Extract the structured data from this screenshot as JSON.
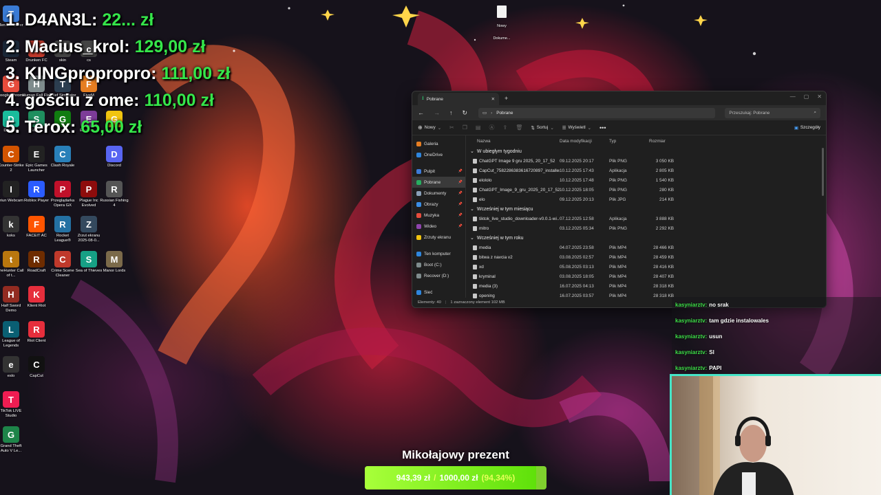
{
  "leaderboard": [
    {
      "name": "1. D4AN3L:",
      "amount": "22... zł"
    },
    {
      "name": "2. Macius_krol:",
      "amount": "129,00 zł"
    },
    {
      "name": "3. KINGpropropro:",
      "amount": "111,00 zł"
    },
    {
      "name": "4. gościu z ome:",
      "amount": "110,00 zł"
    },
    {
      "name": "5. Terox:",
      "amount": "65,00 zł"
    }
  ],
  "desktop": {
    "icons": [
      {
        "label": "Ten komputer",
        "icon": "computer-icon",
        "color": "#3a7bd5"
      },
      {
        "label": "Steam",
        "icon": "steam-icon",
        "color": "#1b2838"
      },
      {
        "label": "Drunken FC",
        "icon": "game-icon",
        "color": "#c0392b"
      },
      {
        "label": "skin",
        "icon": "folder-icon",
        "color": "#444"
      },
      {
        "label": "cs",
        "icon": "folder-icon",
        "color": "#444"
      },
      {
        "label": "Google Chrome",
        "icon": "chrome-icon",
        "color": "#e74c3c"
      },
      {
        "label": "Human Fall Flat",
        "icon": "game-icon",
        "color": "#7f8c8d"
      },
      {
        "label": "Thief Simulator",
        "icon": "game-icon",
        "color": "#2c3e50"
      },
      {
        "label": "FiveM",
        "icon": "fivem-icon",
        "color": "#e67e22"
      },
      {
        "label": "Desktop",
        "icon": "app-icon",
        "color": "#1abc9c"
      },
      {
        "label": "Studio",
        "icon": "app-icon",
        "color": "#1f8f5f"
      },
      {
        "label": "Games",
        "icon": "xbox-icon",
        "color": "#107c10"
      },
      {
        "label": "Escape ...",
        "icon": "game-icon",
        "color": "#7d3c98"
      },
      {
        "label": "Games ...",
        "icon": "rockstar-icon",
        "color": "#f1c40f"
      },
      {
        "label": "Counter-Strike 2",
        "icon": "cs2-icon",
        "color": "#d35400"
      },
      {
        "label": "Epic Games Launcher",
        "icon": "epic-icon",
        "color": "#222"
      },
      {
        "label": "Clash Royale",
        "icon": "game-icon",
        "color": "#2980b9"
      },
      {
        "label": "Discord",
        "icon": "discord-icon",
        "color": "#5865f2"
      },
      {
        "label": "Iriun Webcam",
        "icon": "webcam-icon",
        "color": "#222"
      },
      {
        "label": "Roblox Player",
        "icon": "roblox-icon",
        "color": "#2b5cff"
      },
      {
        "label": "Przeglądarka Opera GX",
        "icon": "opera-icon",
        "color": "#c0102a"
      },
      {
        "label": "Plague Inc Evolved",
        "icon": "biohazard-icon",
        "color": "#8e0c0c"
      },
      {
        "label": "Russian Fishing 4",
        "icon": "game-icon",
        "color": "#555"
      },
      {
        "label": "koks",
        "icon": "file-icon",
        "color": "#333"
      },
      {
        "label": "FACEIT AC",
        "icon": "faceit-icon",
        "color": "#ff5500"
      },
      {
        "label": "Rocket League®",
        "icon": "rocket-league-icon",
        "color": "#2471a3"
      },
      {
        "label": "Zrzut ekranu 2025-08-0...",
        "icon": "image-icon",
        "color": "#34495e"
      },
      {
        "label": "theHunter Call of t...",
        "icon": "game-icon",
        "color": "#b9770e"
      },
      {
        "label": "RoadCraft",
        "icon": "game-icon",
        "color": "#6e2c00"
      },
      {
        "label": "Crime Scene Cleaner",
        "icon": "game-icon",
        "color": "#c0392b"
      },
      {
        "label": "Sea of Thieves",
        "icon": "game-icon",
        "color": "#16a085"
      },
      {
        "label": "Manor Lords",
        "icon": "game-icon",
        "color": "#7b6a4a"
      },
      {
        "label": "Half Sword Demo",
        "icon": "game-icon",
        "color": "#922b21"
      },
      {
        "label": "Klient Riot",
        "icon": "riot-icon",
        "color": "#e62e3c"
      },
      {
        "label": "League of Legends",
        "icon": "lol-icon",
        "color": "#0a5f73"
      },
      {
        "label": "Riot Client",
        "icon": "riot-icon",
        "color": "#e62e3c"
      },
      {
        "label": "eslo",
        "icon": "file-icon",
        "color": "#333"
      },
      {
        "label": "CapCut",
        "icon": "capcut-icon",
        "color": "#111"
      },
      {
        "label": "TikTok LIVE Studio",
        "icon": "tiktok-icon",
        "color": "#ee1d52"
      },
      {
        "label": "Grand Theft Auto V Le...",
        "icon": "gta-icon",
        "color": "#1e8449"
      }
    ],
    "newdoc_label": "Nowy Dokume..."
  },
  "explorer": {
    "tab_title": "Pobrane",
    "address": "Pobrane",
    "search_placeholder": "Przeszukaj: Pobrane",
    "toolbar": {
      "new": "Nowy",
      "sort": "Sortuj",
      "view": "Wyświetl",
      "details": "Szczegóły"
    },
    "nav": [
      {
        "label": "Galeria",
        "color": "#e67e22",
        "pinned": false
      },
      {
        "label": "OneDrive",
        "color": "#2e86de",
        "pinned": false
      },
      {
        "label": "Pulpit",
        "color": "#3d7bd9",
        "pinned": true
      },
      {
        "label": "Pobrane",
        "color": "#27ae60",
        "pinned": true
      },
      {
        "label": "Dokumenty",
        "color": "#8aa0b8",
        "pinned": true
      },
      {
        "label": "Obrazy",
        "color": "#3a8ee6",
        "pinned": true
      },
      {
        "label": "Muzyka",
        "color": "#e74c3c",
        "pinned": true
      },
      {
        "label": "Wideo",
        "color": "#8e44ad",
        "pinned": true
      },
      {
        "label": "Zrzuty ekranu",
        "color": "#f1c40f",
        "pinned": false
      },
      {
        "label": "Ten komputer",
        "color": "#2e86de",
        "pinned": false
      },
      {
        "label": "Boot (C:)",
        "color": "#7f8c8d",
        "pinned": false
      },
      {
        "label": "Recover (D:)",
        "color": "#7f8c8d",
        "pinned": false
      },
      {
        "label": "Sieć",
        "color": "#2e86de",
        "pinned": false
      }
    ],
    "columns": {
      "name": "Nazwa",
      "date": "Data modyfikacji",
      "type": "Typ",
      "size": "Rozmiar"
    },
    "groups": [
      {
        "label": "W ubiegłym tygodniu",
        "rows": [
          {
            "name": "ChatGPT Image 9 gru 2025, 20_17_52",
            "date": "09.12.2025 20:17",
            "type": "Plik PNG",
            "size": "3 050 KB"
          },
          {
            "name": "CapCut_7582286383616720897_installer",
            "date": "10.12.2025 17:43",
            "type": "Aplikacja",
            "size": "2 805 KB"
          },
          {
            "name": "elololo",
            "date": "10.12.2025 17:48",
            "type": "Plik PNG",
            "size": "1 540 KB"
          },
          {
            "name": "ChatGPT_Image_9_gru_2025_20_17_52-r...",
            "date": "10.12.2025 18:05",
            "type": "Plik PNG",
            "size": "280 KB"
          },
          {
            "name": "elo",
            "date": "09.12.2025 20:13",
            "type": "Plik JPG",
            "size": "214 KB"
          }
        ]
      },
      {
        "label": "Wcześniej w tym miesiącu",
        "rows": [
          {
            "name": "tiktok_live_studio_downloader-v0.0.1-wi...",
            "date": "07.12.2025 12:58",
            "type": "Aplikacja",
            "size": "3 888 KB"
          },
          {
            "name": "mitro",
            "date": "03.12.2025 05:34",
            "type": "Plik PNG",
            "size": "2 292 KB"
          }
        ]
      },
      {
        "label": "Wcześniej w tym roku",
        "rows": [
          {
            "name": "media",
            "date": "04.07.2025 23:58",
            "type": "Plik MP4",
            "size": "28 466 KB"
          },
          {
            "name": "bitwa z navcia v2",
            "date": "03.08.2025 02:57",
            "type": "Plik MP4",
            "size": "28 459 KB"
          },
          {
            "name": "xd",
            "date": "05.08.2025 03:13",
            "type": "Plik MP4",
            "size": "28 416 KB"
          },
          {
            "name": "kryminal",
            "date": "03.08.2025 18:05",
            "type": "Plik MP4",
            "size": "28 407 KB"
          },
          {
            "name": "media (3)",
            "date": "16.07.2025 04:13",
            "type": "Plik MP4",
            "size": "28 318 KB"
          },
          {
            "name": "opening",
            "date": "16.07.2025 03:57",
            "type": "Plik MP4",
            "size": "28 318 KB"
          }
        ]
      }
    ],
    "status": {
      "count": "Elementy: 40",
      "selected": "1 zaznaczony element  102 MB"
    }
  },
  "chat": [
    {
      "user": "kasyniarztv:",
      "message": "no srak"
    },
    {
      "user": "kasyniarztv:",
      "message": "tam gdzie instalowales"
    },
    {
      "user": "kasyniarztv:",
      "message": "usun"
    },
    {
      "user": "kasyniarztv:",
      "message": "Sl"
    },
    {
      "user": "kasyniarztv:",
      "message": "PAPI"
    }
  ],
  "goal": {
    "title": "Mikołajowy prezent",
    "current": "943,39 zł",
    "separator": "/",
    "target": "1000,00 zł",
    "percent_label": "(94,34%)",
    "progress": 0.9434
  }
}
